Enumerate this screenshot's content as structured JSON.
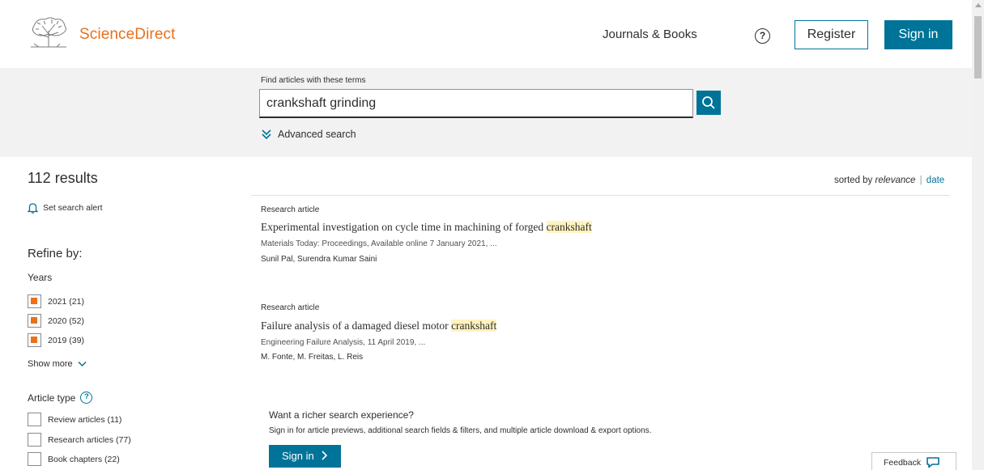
{
  "header": {
    "brand": "ScienceDirect",
    "journals_books": "Journals & Books",
    "help_glyph": "?",
    "register": "Register",
    "sign_in": "Sign in"
  },
  "search": {
    "label": "Find articles with these terms",
    "query": "crankshaft grinding",
    "advanced": "Advanced search"
  },
  "sidebar": {
    "results_count": "112 results",
    "alert": "Set search alert",
    "refine": "Refine by:",
    "years_heading": "Years",
    "years": [
      {
        "label": "2021 (21)",
        "checked": true
      },
      {
        "label": "2020 (52)",
        "checked": true
      },
      {
        "label": "2019 (39)",
        "checked": true
      }
    ],
    "show_more": "Show more",
    "article_type_heading": "Article type",
    "article_types": [
      {
        "label": "Review articles (11)",
        "checked": false
      },
      {
        "label": "Research articles (77)",
        "checked": false
      },
      {
        "label": "Book chapters (22)",
        "checked": false
      }
    ]
  },
  "sort": {
    "prefix": "sorted by",
    "active": "relevance",
    "separator": "|",
    "alt": "date"
  },
  "results": [
    {
      "type": "Research article",
      "title": "Experimental investigation on cycle time in machining of forged",
      "highlight": "crankshaft",
      "source": "Materials Today: Proceedings, Available online 7 January 2021, ...",
      "authors": "Sunil Pal, Surendra Kumar Saini"
    },
    {
      "type": "Research article",
      "title": "Failure analysis of a damaged diesel motor",
      "highlight": "crankshaft",
      "source": "Engineering Failure Analysis, 11 April 2019, ...",
      "authors": "M. Fonte, M. Freitas, L. Reis"
    }
  ],
  "promo": {
    "heading": "Want a richer search experience?",
    "text": "Sign in for article previews, additional search fields & filters, and multiple article download & export options.",
    "button": "Sign in"
  },
  "feedback": "Feedback",
  "colors": {
    "accent": "#007398",
    "brand_orange": "#e9711c",
    "highlight": "#fff3bf"
  }
}
